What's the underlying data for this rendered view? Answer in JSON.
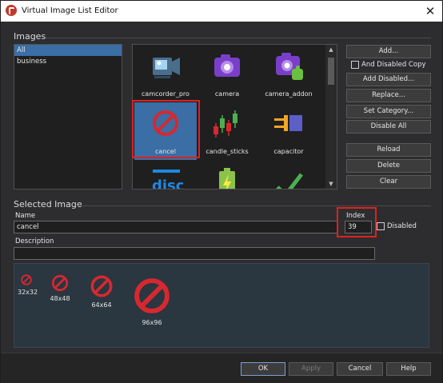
{
  "window": {
    "title": "Virtual Image List Editor",
    "close_glyph": "✕"
  },
  "images_group": {
    "title": "Images",
    "categories": [
      {
        "label": "All",
        "selected": true
      },
      {
        "label": "business",
        "selected": false
      }
    ],
    "grid": [
      {
        "label": "camcorder_pro",
        "icon": "camcorder-icon"
      },
      {
        "label": "camera",
        "icon": "camera-icon"
      },
      {
        "label": "camera_addon",
        "icon": "camera-addon-icon"
      },
      {
        "label": "cancel",
        "icon": "cancel-icon",
        "selected": true
      },
      {
        "label": "candle_sticks",
        "icon": "candlesticks-icon"
      },
      {
        "label": "capacitor",
        "icon": "capacitor-icon"
      },
      {
        "label": "",
        "icon": "disc-icon"
      },
      {
        "label": "",
        "icon": "battery-icon"
      },
      {
        "label": "",
        "icon": "checkmark-icon"
      }
    ],
    "buttons": {
      "add": "Add...",
      "and_disabled_copy": "And Disabled Copy",
      "add_disabled": "Add Disabled...",
      "replace": "Replace...",
      "set_category": "Set Category...",
      "disable_all": "Disable All",
      "reload": "Reload",
      "delete": "Delete",
      "clear": "Clear"
    }
  },
  "selected_group": {
    "title": "Selected Image",
    "name_label": "Name",
    "name_value": "cancel",
    "index_label": "Index",
    "index_value": "39",
    "disabled_label": "Disabled",
    "description_label": "Description",
    "description_value": "",
    "previews": [
      {
        "size": "32x32"
      },
      {
        "size": "48x48"
      },
      {
        "size": "64x64"
      },
      {
        "size": "96x96"
      }
    ]
  },
  "footer": {
    "ok": "OK",
    "apply": "Apply",
    "cancel": "Cancel",
    "help": "Help"
  },
  "colors": {
    "accent_selection": "#3a6ea5",
    "highlight_frame": "#e02020",
    "cancel_icon_red": "#d7282f"
  }
}
